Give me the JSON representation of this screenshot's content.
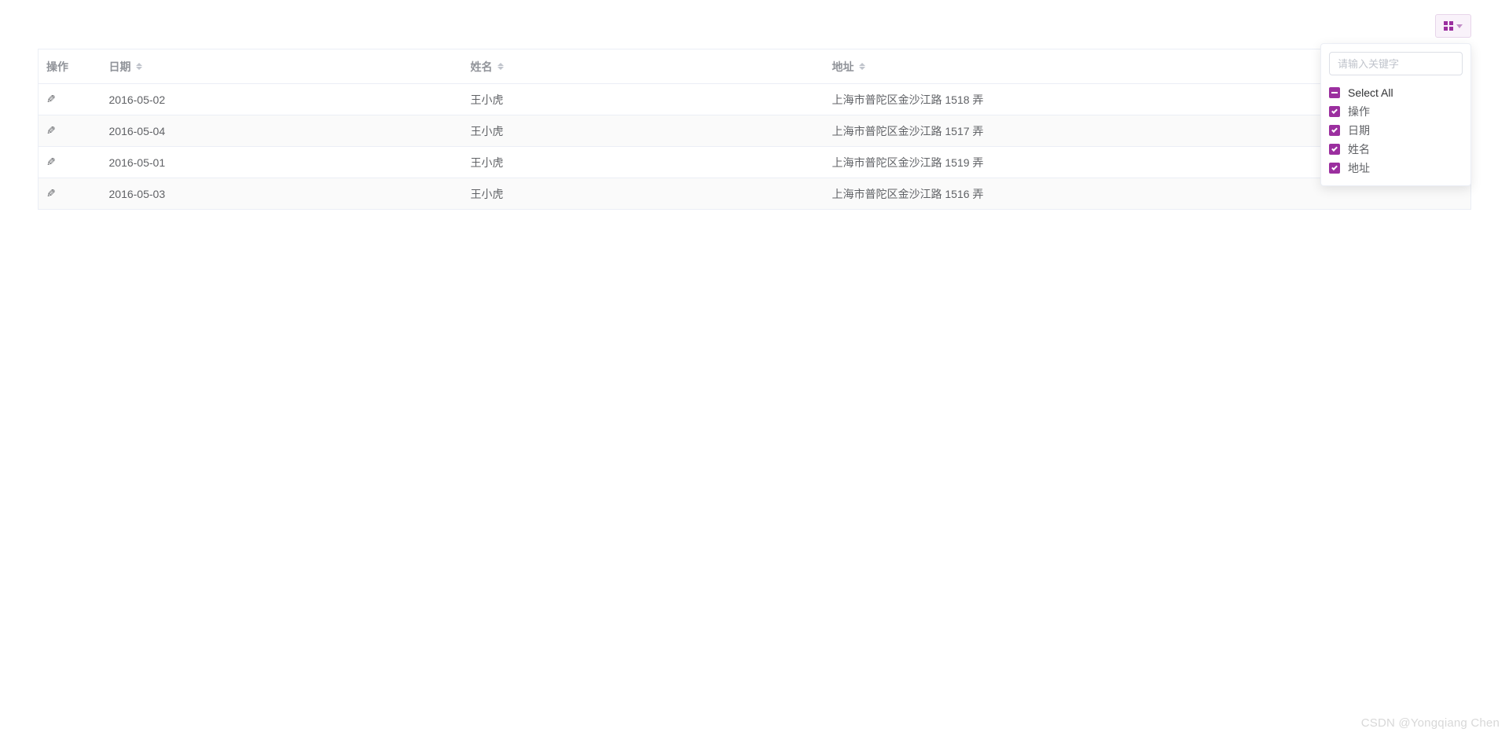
{
  "toolbar": {
    "settings_icon": "grid"
  },
  "table": {
    "headers": {
      "action": "操作",
      "date": "日期",
      "name": "姓名",
      "address": "地址"
    },
    "rows": [
      {
        "date": "2016-05-02",
        "name": "王小虎",
        "address": "上海市普陀区金沙江路 1518 弄"
      },
      {
        "date": "2016-05-04",
        "name": "王小虎",
        "address": "上海市普陀区金沙江路 1517 弄"
      },
      {
        "date": "2016-05-01",
        "name": "王小虎",
        "address": "上海市普陀区金沙江路 1519 弄"
      },
      {
        "date": "2016-05-03",
        "name": "王小虎",
        "address": "上海市普陀区金沙江路 1516 弄"
      }
    ]
  },
  "popover": {
    "search_placeholder": "请输入关键字",
    "select_all": "Select All",
    "options": [
      {
        "label": "操作",
        "checked": true
      },
      {
        "label": "日期",
        "checked": true
      },
      {
        "label": "姓名",
        "checked": true
      },
      {
        "label": "地址",
        "checked": true
      }
    ]
  },
  "watermark": "CSDN @Yongqiang Chen"
}
